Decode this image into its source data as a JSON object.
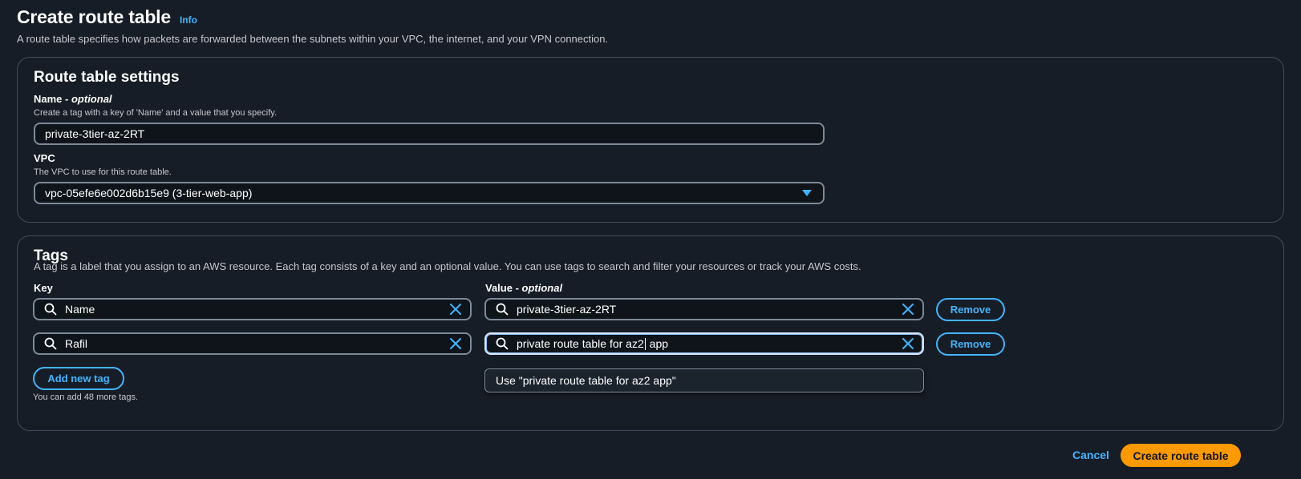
{
  "header": {
    "title": "Create route table",
    "info_label": "Info",
    "description": "A route table specifies how packets are forwarded between the subnets within your VPC, the internet, and your VPN connection."
  },
  "settings": {
    "title": "Route table settings",
    "name_label": "Name",
    "name_optional": "optional",
    "name_description": "Create a tag with a key of 'Name' and a value that you specify.",
    "name_value": "private-3tier-az-2RT",
    "vpc_label": "VPC",
    "vpc_description": "The VPC to use for this route table.",
    "vpc_value": "vpc-05efe6e002d6b15e9 (3-tier-web-app)"
  },
  "tags": {
    "title": "Tags",
    "description": "A tag is a label that you assign to an AWS resource. Each tag consists of a key and an optional value. You can use tags to search and filter your resources or track your AWS costs.",
    "key_header": "Key",
    "value_header": "Value",
    "value_optional": "optional",
    "rows": [
      {
        "key": "Name",
        "value": "private-3tier-az-2RT",
        "remove_label": "Remove"
      },
      {
        "key": "Rafil",
        "value_before_cursor": "private route table for az2",
        "value_after_cursor": " app",
        "remove_label": "Remove"
      }
    ],
    "suggestion": "Use \"private route table for az2 app\"",
    "add_label": "Add new tag",
    "limit_text": "You can add 48 more tags."
  },
  "footer": {
    "cancel_label": "Cancel",
    "create_label": "Create route table"
  },
  "colors": {
    "background": "#161d26",
    "accent": "#42b4ff",
    "primary": "#ff9900"
  }
}
